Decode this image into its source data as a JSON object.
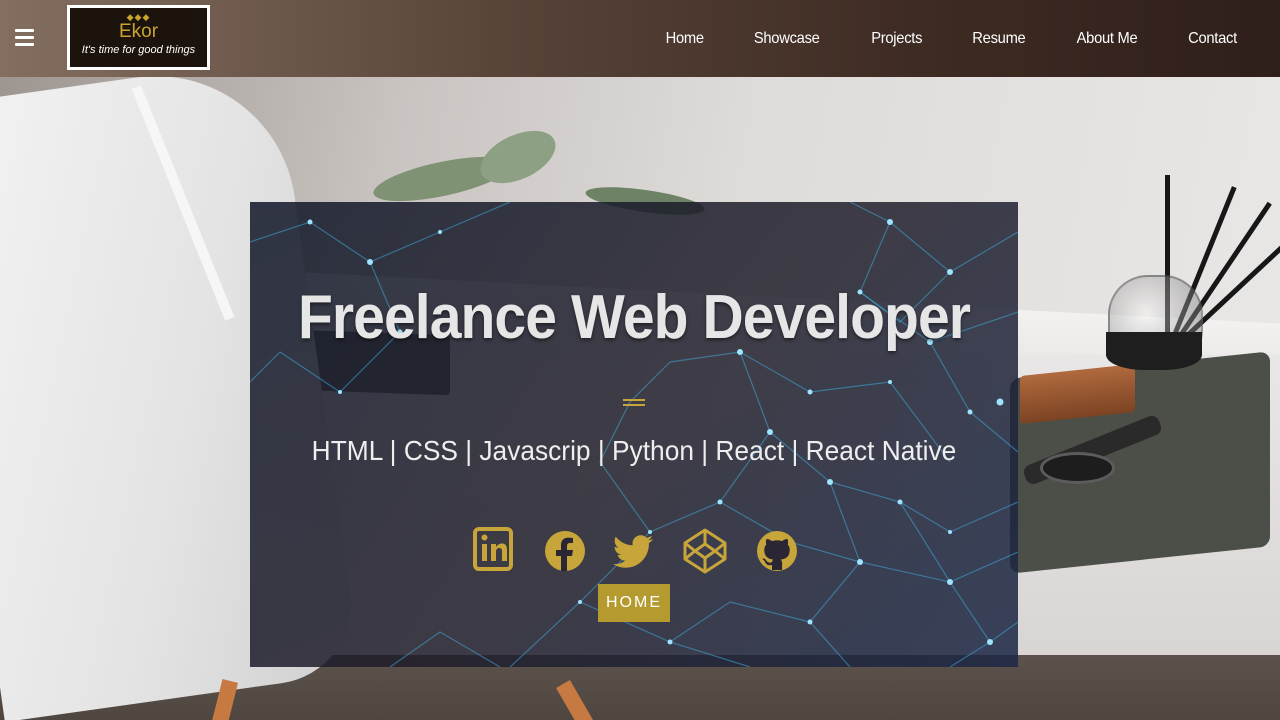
{
  "header": {
    "logo": {
      "diamonds": "◆◆◆",
      "name": "Ekor",
      "tagline": "It's time for good things"
    },
    "nav": [
      "Home",
      "Showcase",
      "Projects",
      "Resume",
      "About Me",
      "Contact"
    ]
  },
  "hero": {
    "title": "Freelance Web Developer",
    "skills": "HTML | CSS | Javascrip | Python | React | React Native",
    "socials": [
      "linkedin-icon",
      "facebook-icon",
      "twitter-icon",
      "codepen-icon",
      "github-icon"
    ],
    "button_label": "HOME"
  },
  "colors": {
    "accent": "#c7a53a",
    "button": "#b59a2f",
    "header_dark": "#2f1f1a",
    "header_light": "#846e60",
    "text": "#ffffff"
  }
}
